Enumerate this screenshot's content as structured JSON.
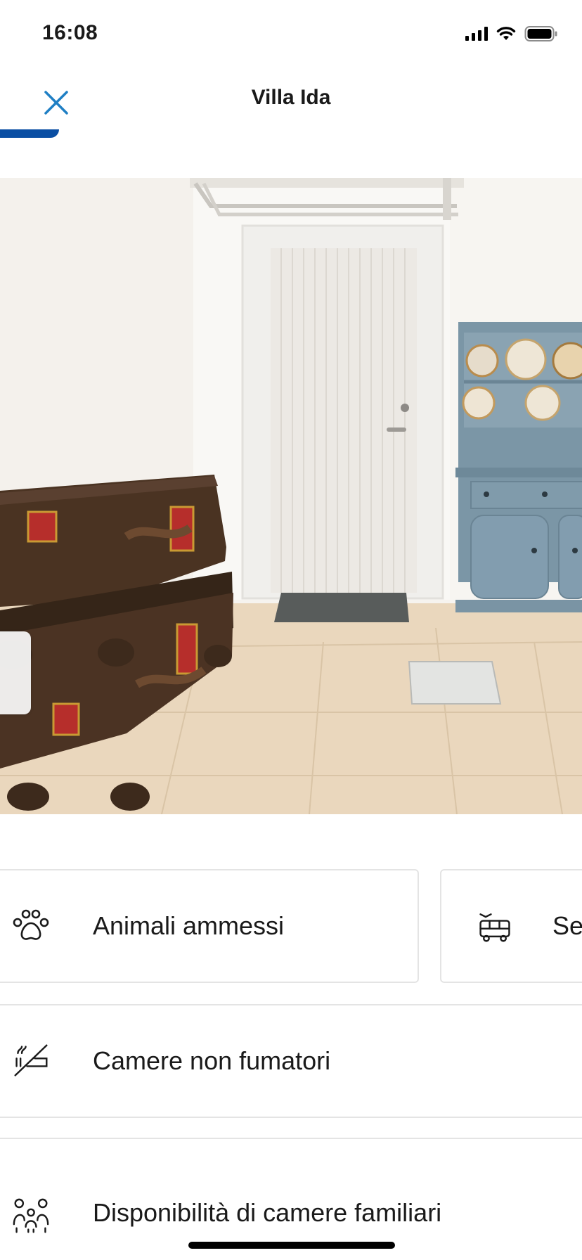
{
  "status_bar": {
    "time": "16:08",
    "icons": [
      "signal-icon",
      "wifi-icon",
      "battery-icon"
    ]
  },
  "header": {
    "title": "Villa Ida",
    "close_icon": "close-icon",
    "accent_color": "#0a4ea3",
    "close_color": "#1f7fc4"
  },
  "photo": {
    "subject": "villa-interior-photo"
  },
  "facilities": [
    {
      "label": "Animali ammessi",
      "icon": "paw-icon"
    },
    {
      "label": "Se",
      "icon": "shuttle-bus-icon"
    },
    {
      "label": "Camere non fumatori",
      "icon": "no-smoking-icon"
    },
    {
      "label": "Disponibilità di camere familiari",
      "icon": "family-icon"
    }
  ]
}
